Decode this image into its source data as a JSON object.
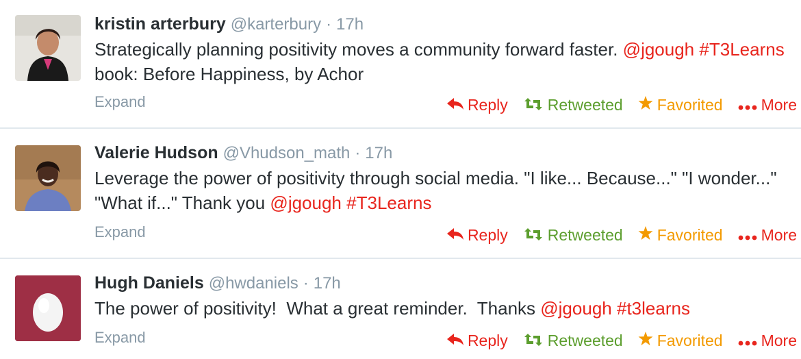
{
  "tweets": [
    {
      "name": "kristin arterbury",
      "handle": "@karterbury",
      "sep": "·",
      "time": "17h",
      "text_parts": [
        {
          "text": "Strategically planning positivity moves a community forward faster. ",
          "type": "plain"
        },
        {
          "text": "@jgough",
          "type": "mention"
        },
        {
          "text": " ",
          "type": "plain"
        },
        {
          "text": "#T3Learns",
          "type": "hashtag"
        },
        {
          "text": " book: Before Happiness, by Achor",
          "type": "plain"
        }
      ],
      "avatar_icon": "profile-photo"
    },
    {
      "name": "Valerie Hudson",
      "handle": "@Vhudson_math",
      "sep": "·",
      "time": "17h",
      "text_parts": [
        {
          "text": "Leverage the power of positivity through social media. \"I like... Because...\" \"I wonder...\" \"What if...\" Thank you ",
          "type": "plain"
        },
        {
          "text": "@jgough",
          "type": "mention"
        },
        {
          "text": " ",
          "type": "plain"
        },
        {
          "text": "#T3Learns",
          "type": "hashtag"
        }
      ],
      "avatar_icon": "profile-photo"
    },
    {
      "name": "Hugh Daniels",
      "handle": "@hwdaniels",
      "sep": "·",
      "time": "17h",
      "text_parts": [
        {
          "text": "The power of positivity!  What a great reminder.  Thanks ",
          "type": "plain"
        },
        {
          "text": "@jgough",
          "type": "mention"
        },
        {
          "text": " ",
          "type": "plain"
        },
        {
          "text": "#t3learns",
          "type": "hashtag"
        }
      ],
      "avatar_icon": "default-egg"
    }
  ],
  "labels": {
    "expand": "Expand",
    "reply": "Reply",
    "retweeted": "Retweeted",
    "favorited": "Favorited",
    "more": "More"
  },
  "icons": {
    "reply": "reply-arrow-icon",
    "retweet": "retweet-icon",
    "favorite": "star-icon",
    "more": "dots-icon"
  },
  "colors": {
    "link": "#e8251d",
    "retweeted": "#5c9e2e",
    "favorited": "#f39a00",
    "muted": "#8899a6",
    "egg_bg": "#9e2f45"
  }
}
